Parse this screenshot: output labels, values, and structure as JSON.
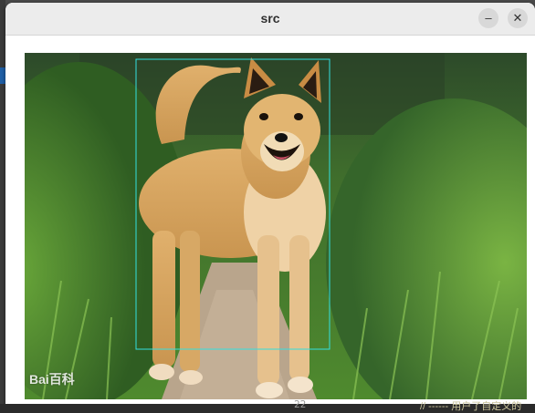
{
  "window": {
    "title": "src",
    "minimize_symbol": "–",
    "close_symbol": "✕"
  },
  "image": {
    "subject": "dog",
    "watermark": "Bai百科",
    "detection_box_color": "#33e0e0"
  },
  "background": {
    "line_number": "22",
    "code_text": "// ------ 用户了自定义的"
  },
  "colors": {
    "grass": "#4f8a2e",
    "dog_fur": "#d9a866",
    "path": "#b9a58c"
  }
}
